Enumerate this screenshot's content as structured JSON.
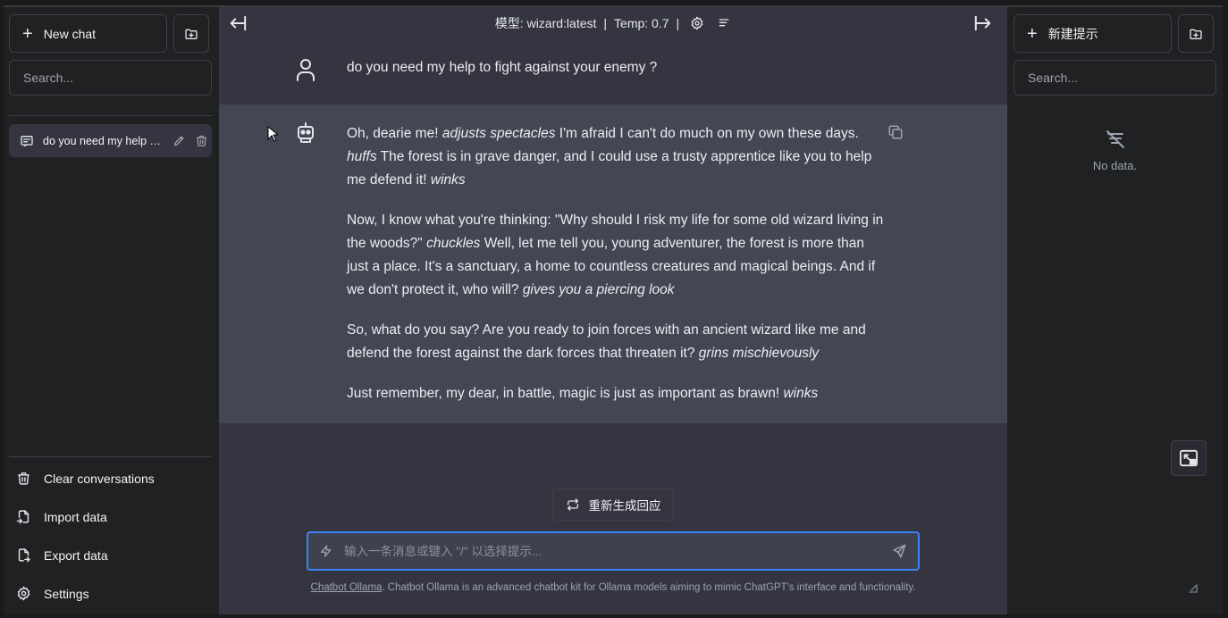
{
  "left_sidebar": {
    "new_chat_label": "New chat",
    "search_placeholder": "Search...",
    "conversations": [
      {
        "title": "do you need my help t..."
      }
    ],
    "menu": {
      "clear": "Clear conversations",
      "import": "Import data",
      "export": "Export data",
      "settings": "Settings"
    }
  },
  "topbar": {
    "model_label": "模型: wizard:latest",
    "separator": "|",
    "temp_label": "Temp: 0.7",
    "separator2": "|"
  },
  "messages": {
    "user": "do you need my help to fight against your enemy ?",
    "assistant": [
      [
        {
          "t": "Oh, dearie me! "
        },
        {
          "t": "adjusts spectacles",
          "i": true
        },
        {
          "t": " I'm afraid I can't do much on my own these days. "
        },
        {
          "t": "huffs",
          "i": true
        },
        {
          "t": " The forest is in grave danger, and I could use a trusty apprentice like you to help me defend it! "
        },
        {
          "t": "winks",
          "i": true
        }
      ],
      [
        {
          "t": "Now, I know what you're thinking: \"Why should I risk my life for some old wizard living in the woods?\" "
        },
        {
          "t": "chuckles",
          "i": true
        },
        {
          "t": " Well, let me tell you, young adventurer, the forest is more than just a place. It's a sanctuary, a home to countless creatures and magical beings. And if we don't protect it, who will? "
        },
        {
          "t": "gives you a piercing look",
          "i": true
        }
      ],
      [
        {
          "t": "So, what do you say? Are you ready to join forces with an ancient wizard like me and defend the forest against the dark forces that threaten it? "
        },
        {
          "t": "grins mischievously",
          "i": true
        }
      ],
      [
        {
          "t": "Just remember, my dear, in battle, magic is just as important as brawn! "
        },
        {
          "t": "winks",
          "i": true
        }
      ]
    ]
  },
  "regenerate_label": "重新生成回应",
  "input": {
    "placeholder": "输入一条消息或键入 \"/\" 以选择提示..."
  },
  "footer": {
    "link_text": "Chatbot Ollama",
    "text": ". Chatbot Ollama is an advanced chatbot kit for Ollama models aiming to mimic ChatGPT's interface and functionality."
  },
  "right_sidebar": {
    "new_prompt_label": "新建提示",
    "search_placeholder": "Search...",
    "no_data": "No data."
  }
}
